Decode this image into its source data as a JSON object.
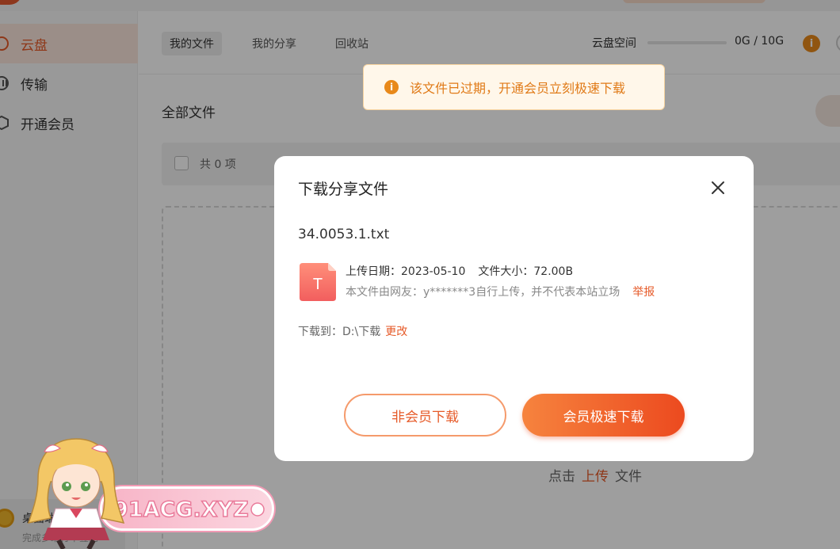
{
  "sidebar": {
    "items": [
      {
        "label": "云盘",
        "icon": "cloud-icon",
        "active": true
      },
      {
        "label": "传输",
        "icon": "transfer-icon",
        "active": false
      },
      {
        "label": "开通会员",
        "icon": "vip-icon",
        "active": false
      }
    ],
    "bottom": {
      "title": "桌面端签到",
      "subtitle": "完成多端打卡签到"
    }
  },
  "header": {
    "tabs": [
      {
        "label": "我的文件",
        "active": true
      },
      {
        "label": "我的分享",
        "active": false
      },
      {
        "label": "回收站",
        "active": false
      }
    ],
    "space_label": "云盘空间",
    "space_value": "0G / 10G",
    "space_used_fraction": 0
  },
  "main": {
    "title": "全部文件",
    "count_text": "共 0 项",
    "hint_prefix": "点击",
    "hint_link": "上传",
    "hint_suffix": "文件"
  },
  "toast": {
    "message": "该文件已过期，开通会员立刻极速下载"
  },
  "dialog": {
    "title": "下载分享文件",
    "file_name": "34.0053.1.txt",
    "file_icon_letter": "T",
    "upload_date": "上传日期：2023-05-10",
    "file_size": "文件大小：72.00B",
    "disclaimer": "本文件由网友：y*******3自行上传，并不代表本站立场",
    "report": "举报",
    "download_to": "下载到：D:\\下载",
    "change": "更改",
    "btn_free": "非会员下载",
    "btn_vip": "会员极速下载"
  },
  "watermark": {
    "text": "91ACG.XYZ"
  },
  "colors": {
    "accent": "#e65a28",
    "toast_text": "#e07a17",
    "vip_gradient_start": "#f6833e",
    "vip_gradient_end": "#ec4a1f"
  }
}
